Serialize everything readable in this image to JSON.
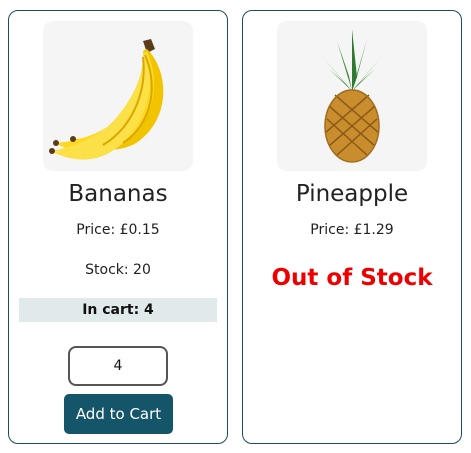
{
  "products": [
    {
      "name": "Bananas",
      "price": "Price: £0.15",
      "stock": "Stock: 20",
      "in_cart": "In cart: 4",
      "quantity": "4",
      "add_button_label": "Add to Cart",
      "image_icon": "banana-image"
    },
    {
      "name": "Pineapple",
      "price": "Price: £1.29",
      "out_of_stock_label": "Out of Stock",
      "image_icon": "pineapple-image"
    }
  ],
  "colors": {
    "border": "#1e4d5c",
    "button_bg": "#15556a",
    "in_cart_bg": "#e0eaea",
    "out_of_stock": "#ee0000"
  }
}
